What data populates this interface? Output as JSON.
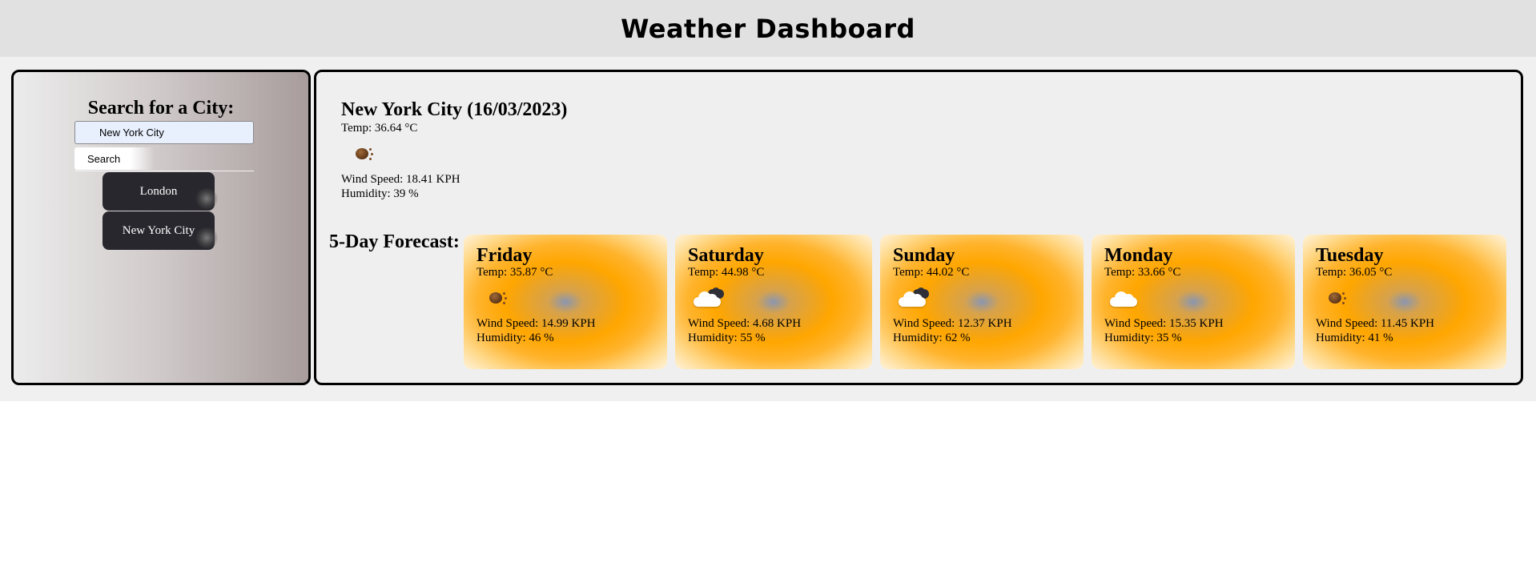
{
  "app": {
    "title": "Weather Dashboard"
  },
  "search": {
    "heading": "Search for a City:",
    "input_value": "New York City",
    "button_label": "Search"
  },
  "history": [
    "London",
    "New York City"
  ],
  "current": {
    "title": "New York City (16/03/2023)",
    "temp": "Temp: 36.64 °C",
    "icon": "clear-sun-icon",
    "wind": "Wind Speed: 18.41 KPH",
    "humidity": "Humidity: 39 %"
  },
  "forecast": {
    "heading": "5-Day Forecast:",
    "days": [
      {
        "day": "Friday",
        "temp": "Temp: 35.87 °C",
        "icon": "clear-sun-icon",
        "wind": "Wind Speed: 14.99 KPH",
        "humidity": "Humidity: 46 %"
      },
      {
        "day": "Saturday",
        "temp": "Temp: 44.98 °C",
        "icon": "broken-clouds-icon",
        "wind": "Wind Speed: 4.68 KPH",
        "humidity": "Humidity: 55 %"
      },
      {
        "day": "Sunday",
        "temp": "Temp: 44.02 °C",
        "icon": "broken-clouds-icon",
        "wind": "Wind Speed: 12.37 KPH",
        "humidity": "Humidity: 62 %"
      },
      {
        "day": "Monday",
        "temp": "Temp: 33.66 °C",
        "icon": "cloud-icon",
        "wind": "Wind Speed: 15.35 KPH",
        "humidity": "Humidity: 35 %"
      },
      {
        "day": "Tuesday",
        "temp": "Temp: 36.05 °C",
        "icon": "clear-sun-icon",
        "wind": "Wind Speed: 11.45 KPH",
        "humidity": "Humidity: 41 %"
      }
    ]
  },
  "colors": {
    "header_bg": "#e1e1e1",
    "content_bg": "#f0f0f0",
    "history_button_bg": "#27272d",
    "card_accent": "#ffa600"
  }
}
